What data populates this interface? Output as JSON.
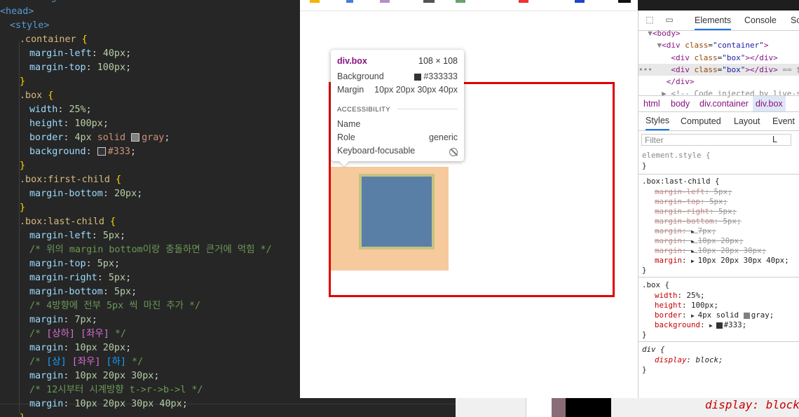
{
  "editor": {
    "lines": [
      {
        "t": "html_lang",
        "text": "<html lang=\"ko\">"
      },
      {
        "t": "head",
        "text": "<head>"
      },
      {
        "t": "style",
        "text": "<style>"
      },
      {
        "t": "sel",
        "text": ".container {"
      },
      {
        "t": "decl",
        "prop": "margin-left",
        "val": "40px"
      },
      {
        "t": "decl",
        "prop": "margin-top",
        "val": "100px"
      },
      {
        "t": "close",
        "text": "}"
      },
      {
        "t": "sel",
        "text": ".box {"
      },
      {
        "t": "decl",
        "prop": "width",
        "val": "25%"
      },
      {
        "t": "decl",
        "prop": "height",
        "val": "100px"
      },
      {
        "t": "border",
        "prop": "border",
        "val1": "4px",
        "val2": "solid",
        "val3": "gray"
      },
      {
        "t": "bg",
        "prop": "background",
        "val": "#333"
      },
      {
        "t": "close",
        "text": "}"
      },
      {
        "t": "sel",
        "text": ".box:first-child {"
      },
      {
        "t": "decl",
        "prop": "margin-bottom",
        "val": "20px"
      },
      {
        "t": "close",
        "text": "}"
      },
      {
        "t": "sel",
        "text": ".box:last-child {"
      },
      {
        "t": "decl",
        "prop": "margin-left",
        "val": "5px"
      },
      {
        "t": "comment",
        "text": "/* 위의 margin bottom이랑 충돌하면 큰거에 먹힘 */"
      },
      {
        "t": "decl",
        "prop": "margin-top",
        "val": "5px"
      },
      {
        "t": "decl",
        "prop": "margin-right",
        "val": "5px"
      },
      {
        "t": "decl",
        "prop": "margin-bottom",
        "val": "5px"
      },
      {
        "t": "comment",
        "text": "/* 4방향에 전부 5px 씩 마진 추가 */"
      },
      {
        "t": "decl",
        "prop": "margin",
        "val": "7px"
      },
      {
        "t": "comment2",
        "a": "/* ",
        "b": "[상하]",
        "c": " ",
        "d": "[좌우]",
        "e": " */"
      },
      {
        "t": "decl",
        "prop": "margin",
        "val": "10px 20px"
      },
      {
        "t": "comment3",
        "a": "/* ",
        "b": "[상]",
        "c": " ",
        "d": "[좌우]",
        "e": " ",
        "f": "[하]",
        "g": " */"
      },
      {
        "t": "decl",
        "prop": "margin",
        "val": "10px 20px 30px"
      },
      {
        "t": "comment",
        "text": "/* 12시부터 시계방향 t->r->b->l */"
      },
      {
        "t": "decl",
        "prop": "margin",
        "val": "10px 20px 30px 40px"
      },
      {
        "t": "close",
        "text": "}"
      }
    ]
  },
  "tooltip": {
    "title": "div.box",
    "dims": "108 × 108",
    "background_label": "Background",
    "background_value": "#333333",
    "margin_label": "Margin",
    "margin_value": "10px 20px 30px 40px",
    "accessibility_label": "ACCESSIBILITY",
    "name_label": "Name",
    "role_label": "Role",
    "role_value": "generic",
    "keyboard_label": "Keyboard-focusable"
  },
  "devtools": {
    "tabs": [
      "Elements",
      "Console",
      "Sc"
    ],
    "dom": [
      {
        "indent": "  ▼",
        "tag": "<body>"
      },
      {
        "indent": "    ▼",
        "open": "<div ",
        "attr": "class",
        "val": "\"container\"",
        "close": ">"
      },
      {
        "indent": "       ",
        "open": "<div ",
        "attr": "class",
        "val": "\"box\"",
        "close": "></div>"
      },
      {
        "indent": "•••    ",
        "open": "<div ",
        "attr": "class",
        "val": "\"box\"",
        "close": "></div>",
        "extra": " == $0"
      },
      {
        "indent": "      ",
        "tag": "</div>"
      },
      {
        "indent": "     ▶ ",
        "text": "<!-- Code injected by live-se"
      }
    ],
    "breadcrumbs": [
      "html",
      "body",
      "div.container",
      "div.box"
    ],
    "subtabs": [
      "Styles",
      "Computed",
      "Layout",
      "Event L"
    ],
    "filter_placeholder": "Filter",
    "rules": {
      "element_style": "element.style {",
      "last_child_selector": ".box:last-child {",
      "last_child_struck": [
        {
          "p": "margin-left",
          "v": "5px"
        },
        {
          "p": "margin-top",
          "v": "5px"
        },
        {
          "p": "margin-right",
          "v": "5px"
        },
        {
          "p": "margin-bottom",
          "v": "5px"
        },
        {
          "p": "margin",
          "v": "7px"
        },
        {
          "p": "margin",
          "v": "10px 20px"
        },
        {
          "p": "margin",
          "v": "10px 20px 30px"
        }
      ],
      "last_child_active": {
        "p": "margin",
        "v": "10px 20px 30px 40px"
      },
      "box_selector": ".box {",
      "box_decls": [
        {
          "p": "width",
          "v": "25%"
        },
        {
          "p": "height",
          "v": "100px"
        },
        {
          "p": "border",
          "v": "4px solid gray"
        },
        {
          "p": "background",
          "v": "#333"
        }
      ],
      "div_selector": "div {",
      "div_decl": {
        "p": "display",
        "v": "block"
      }
    },
    "peek": "display: block"
  },
  "colors": {
    "highlight_margin": "#f6ca9c",
    "highlight_border": "#c4c283",
    "highlight_content": "#5a7fa6",
    "container_border": "#e00000"
  }
}
